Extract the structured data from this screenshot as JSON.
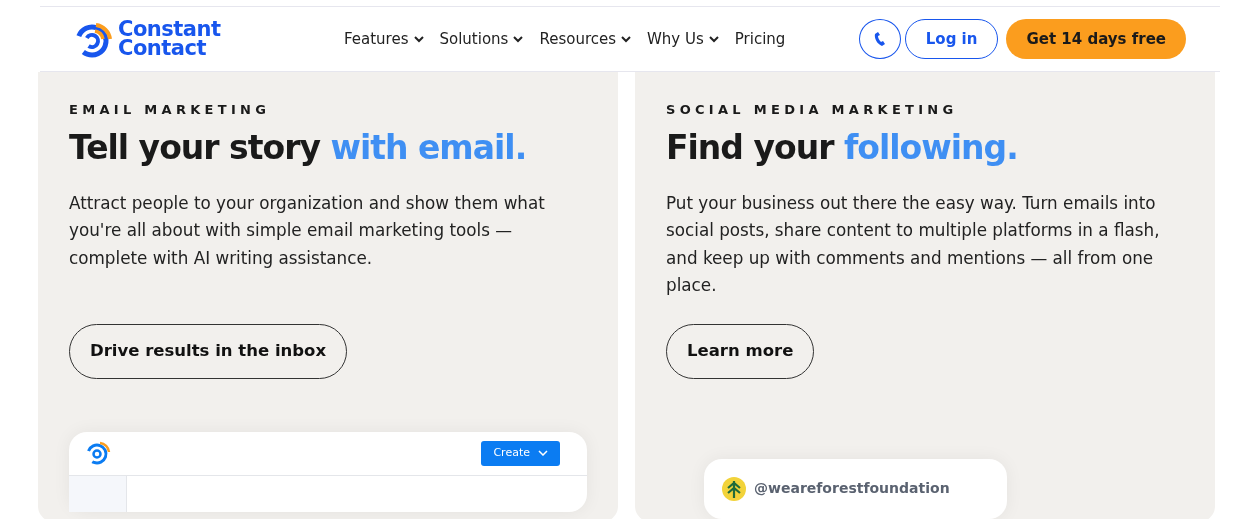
{
  "header": {
    "logo": [
      "Constant",
      "Contact"
    ],
    "nav": [
      {
        "label": "Features",
        "dropdown": true
      },
      {
        "label": "Solutions",
        "dropdown": true
      },
      {
        "label": "Resources",
        "dropdown": true
      },
      {
        "label": "Why Us",
        "dropdown": true
      },
      {
        "label": "Pricing",
        "dropdown": false
      }
    ],
    "login": "Log in",
    "cta": "Get 14 days free"
  },
  "cards": [
    {
      "kind": "email",
      "eyebrow": "EMAIL MARKETING",
      "title": "Tell your story ",
      "title_accent": "with email.",
      "text": "Attract people to your organization and show them what you're all about with simple email marketing tools — complete with AI writing assistance.",
      "button": "Drive results in the inbox",
      "preview": {
        "button": "Create"
      }
    },
    {
      "kind": "social",
      "eyebrow": "SOCIAL MEDIA MARKETING",
      "title": "Find your ",
      "title_accent": "following.",
      "text": "Put your business out there the easy way. Turn emails into social posts, share content to multiple platforms in a flash, and keep up with comments and mentions — all from one place.",
      "button": "Learn more",
      "preview": {
        "handle": "@weareforestfoundation"
      }
    }
  ]
}
